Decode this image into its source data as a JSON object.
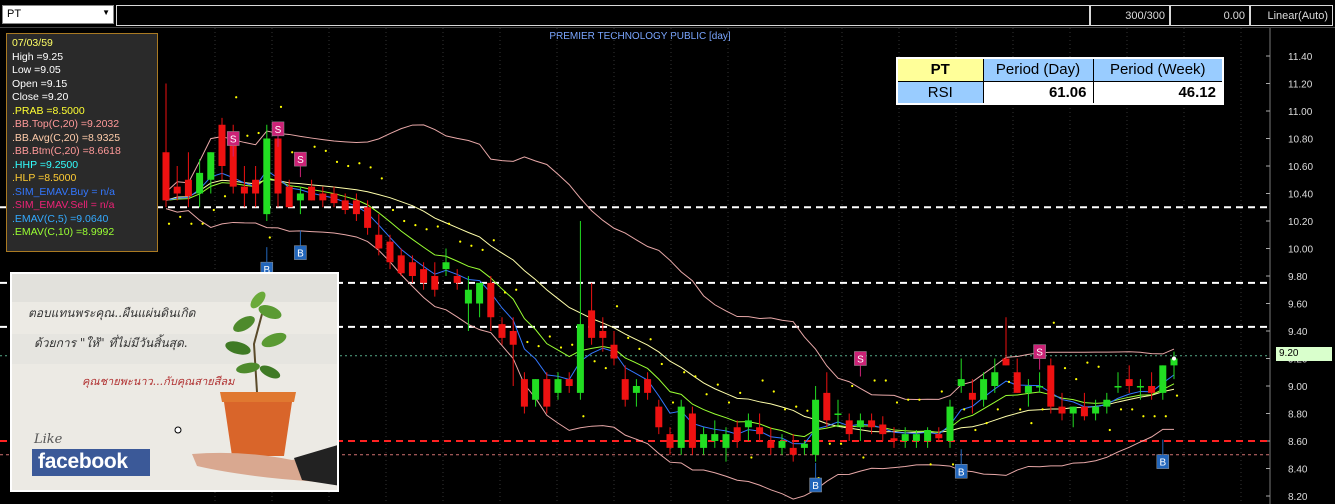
{
  "toolbar": {
    "symbol": "PT",
    "bar_count": "300/300",
    "value": "0.00",
    "scale_mode": "Linear(Auto)"
  },
  "chart": {
    "title": "PREMIER TECHNOLOGY PUBLIC [day]",
    "last_price_tag": "9.20",
    "colors": {
      "up": "#22dd22",
      "down": "#ee1111",
      "bb": "#e8a8a8",
      "ema5": "#3377ff",
      "ema10": "#99ff33",
      "emav": "#ffffaa",
      "sar": "#ffff00"
    }
  },
  "info_panel": {
    "date": "07/03/59",
    "high": "High   =9.25",
    "low": "Low    =9.05",
    "open": "Open   =9.15",
    "close": "Close  =9.20",
    "prab": ".PRAB    =8.5000",
    "bb_top": ".BB.Top(C,20)    =9.2032",
    "bb_avg": ".BB.Avg(C,20)    =8.9325",
    "bb_btm": ".BB.Btm(C,20)    =8.6618",
    "hhp": ".HHP    =9.2500",
    "hlp": ".HLP    =8.5000",
    "sim_buy": ".SIM_EMAV.Buy    = n/a",
    "sim_sell": ".SIM_EMAV.Sell    = n/a",
    "emav5": ".EMAV(C,5)    =9.0640",
    "emav10": ".EMAV(C,10)    =8.9992"
  },
  "rsi_table": {
    "symbol": "PT",
    "col_day": "Period (Day)",
    "col_week": "Period (Week)",
    "row_label": "RSI",
    "day_value": "61.06",
    "week_value": "46.12"
  },
  "promo": {
    "line1": "ตอบแทนพระคุณ..ผืนแผ่นดินเกิด",
    "line2": "ด้วยการ \"ให้\" ที่ไม่มีวันสิ้นสุด.",
    "line3": "คุณชายพะนาว...กับคุณสายสีลม",
    "like": "Like",
    "brand": "facebook"
  },
  "chart_data": {
    "type": "candlestick",
    "title": "PREMIER TECHNOLOGY PUBLIC [day]",
    "ylim": [
      8.2,
      11.6
    ],
    "y_ticks": [
      "11.40",
      "11.20",
      "11.00",
      "10.80",
      "10.60",
      "10.40",
      "10.20",
      "10.00",
      "9.80",
      "9.60",
      "9.40",
      "9.20",
      "9.00",
      "8.80",
      "8.60",
      "8.40",
      "8.20"
    ],
    "last_close": 9.2,
    "horizontal_levels": [
      10.3,
      9.75,
      9.43,
      8.6,
      8.5
    ],
    "candles": [
      {
        "o": 10.7,
        "h": 11.2,
        "l": 10.3,
        "c": 10.35
      },
      {
        "o": 10.45,
        "h": 10.6,
        "l": 10.35,
        "c": 10.4
      },
      {
        "o": 10.5,
        "h": 10.7,
        "l": 10.3,
        "c": 10.38
      },
      {
        "o": 10.4,
        "h": 10.65,
        "l": 10.3,
        "c": 10.55
      },
      {
        "o": 10.5,
        "h": 10.7,
        "l": 10.4,
        "c": 10.7
      },
      {
        "o": 10.9,
        "h": 10.95,
        "l": 10.5,
        "c": 10.6
      },
      {
        "o": 10.8,
        "h": 10.9,
        "l": 10.4,
        "c": 10.45
      },
      {
        "o": 10.45,
        "h": 10.6,
        "l": 10.3,
        "c": 10.4
      },
      {
        "o": 10.5,
        "h": 10.6,
        "l": 10.3,
        "c": 10.4
      },
      {
        "o": 10.25,
        "h": 10.9,
        "l": 10.2,
        "c": 10.8
      },
      {
        "o": 10.8,
        "h": 10.85,
        "l": 10.3,
        "c": 10.4
      },
      {
        "o": 10.45,
        "h": 10.5,
        "l": 10.3,
        "c": 10.3
      },
      {
        "o": 10.35,
        "h": 10.45,
        "l": 10.25,
        "c": 10.4
      },
      {
        "o": 10.45,
        "h": 10.5,
        "l": 10.35,
        "c": 10.35
      },
      {
        "o": 10.4,
        "h": 10.45,
        "l": 10.3,
        "c": 10.35
      },
      {
        "o": 10.4,
        "h": 10.45,
        "l": 10.3,
        "c": 10.33
      },
      {
        "o": 10.35,
        "h": 10.4,
        "l": 10.25,
        "c": 10.28
      },
      {
        "o": 10.35,
        "h": 10.4,
        "l": 10.2,
        "c": 10.25
      },
      {
        "o": 10.3,
        "h": 10.35,
        "l": 10.1,
        "c": 10.15
      },
      {
        "o": 10.1,
        "h": 10.25,
        "l": 9.95,
        "c": 10.0
      },
      {
        "o": 10.05,
        "h": 10.1,
        "l": 9.85,
        "c": 9.9
      },
      {
        "o": 9.95,
        "h": 10.0,
        "l": 9.8,
        "c": 9.82
      },
      {
        "o": 9.9,
        "h": 9.95,
        "l": 9.75,
        "c": 9.8
      },
      {
        "o": 9.85,
        "h": 9.9,
        "l": 9.7,
        "c": 9.75
      },
      {
        "o": 9.8,
        "h": 9.9,
        "l": 9.65,
        "c": 9.7
      },
      {
        "o": 9.85,
        "h": 10.0,
        "l": 9.8,
        "c": 9.9
      },
      {
        "o": 9.8,
        "h": 9.85,
        "l": 9.7,
        "c": 9.75
      },
      {
        "o": 9.6,
        "h": 9.8,
        "l": 9.4,
        "c": 9.7
      },
      {
        "o": 9.6,
        "h": 9.75,
        "l": 9.5,
        "c": 9.75
      },
      {
        "o": 9.75,
        "h": 9.8,
        "l": 9.4,
        "c": 9.5
      },
      {
        "o": 9.45,
        "h": 9.5,
        "l": 9.3,
        "c": 9.35
      },
      {
        "o": 9.4,
        "h": 9.5,
        "l": 9.0,
        "c": 9.3
      },
      {
        "o": 9.05,
        "h": 9.1,
        "l": 8.8,
        "c": 8.85
      },
      {
        "o": 8.9,
        "h": 9.05,
        "l": 8.85,
        "c": 9.05
      },
      {
        "o": 9.05,
        "h": 9.1,
        "l": 8.8,
        "c": 8.85
      },
      {
        "o": 8.95,
        "h": 9.1,
        "l": 8.9,
        "c": 9.05
      },
      {
        "o": 9.05,
        "h": 9.1,
        "l": 8.95,
        "c": 9.0
      },
      {
        "o": 8.95,
        "h": 10.2,
        "l": 8.9,
        "c": 9.45
      },
      {
        "o": 9.55,
        "h": 9.75,
        "l": 9.3,
        "c": 9.35
      },
      {
        "o": 9.4,
        "h": 9.5,
        "l": 9.25,
        "c": 9.35
      },
      {
        "o": 9.3,
        "h": 9.4,
        "l": 9.15,
        "c": 9.2
      },
      {
        "o": 9.05,
        "h": 9.15,
        "l": 8.85,
        "c": 8.9
      },
      {
        "o": 8.95,
        "h": 9.05,
        "l": 8.85,
        "c": 9.0
      },
      {
        "o": 9.05,
        "h": 9.1,
        "l": 8.9,
        "c": 8.95
      },
      {
        "o": 8.85,
        "h": 8.9,
        "l": 8.65,
        "c": 8.7
      },
      {
        "o": 8.65,
        "h": 8.7,
        "l": 8.5,
        "c": 8.55
      },
      {
        "o": 8.55,
        "h": 8.9,
        "l": 8.5,
        "c": 8.85
      },
      {
        "o": 8.8,
        "h": 8.85,
        "l": 8.5,
        "c": 8.55
      },
      {
        "o": 8.55,
        "h": 8.7,
        "l": 8.5,
        "c": 8.65
      },
      {
        "o": 8.6,
        "h": 8.75,
        "l": 8.55,
        "c": 8.65
      },
      {
        "o": 8.55,
        "h": 8.7,
        "l": 8.45,
        "c": 8.65
      },
      {
        "o": 8.7,
        "h": 8.75,
        "l": 8.55,
        "c": 8.6
      },
      {
        "o": 8.7,
        "h": 8.8,
        "l": 8.6,
        "c": 8.75
      },
      {
        "o": 8.7,
        "h": 8.8,
        "l": 8.6,
        "c": 8.65
      },
      {
        "o": 8.6,
        "h": 8.7,
        "l": 8.5,
        "c": 8.55
      },
      {
        "o": 8.55,
        "h": 8.65,
        "l": 8.5,
        "c": 8.6
      },
      {
        "o": 8.55,
        "h": 8.65,
        "l": 8.45,
        "c": 8.5
      },
      {
        "o": 8.55,
        "h": 8.6,
        "l": 8.5,
        "c": 8.58
      },
      {
        "o": 8.5,
        "h": 9.0,
        "l": 8.45,
        "c": 8.9
      },
      {
        "o": 8.95,
        "h": 9.1,
        "l": 8.7,
        "c": 8.75
      },
      {
        "o": 8.8,
        "h": 8.9,
        "l": 8.7,
        "c": 8.8
      },
      {
        "o": 8.75,
        "h": 8.8,
        "l": 8.6,
        "c": 8.65
      },
      {
        "o": 8.7,
        "h": 8.8,
        "l": 8.6,
        "c": 8.75
      },
      {
        "o": 8.75,
        "h": 8.8,
        "l": 8.65,
        "c": 8.7
      },
      {
        "o": 8.72,
        "h": 8.78,
        "l": 8.6,
        "c": 8.65
      },
      {
        "o": 8.62,
        "h": 8.7,
        "l": 8.55,
        "c": 8.6
      },
      {
        "o": 8.6,
        "h": 8.7,
        "l": 8.55,
        "c": 8.65
      },
      {
        "o": 8.6,
        "h": 8.68,
        "l": 8.55,
        "c": 8.65
      },
      {
        "o": 8.6,
        "h": 8.7,
        "l": 8.55,
        "c": 8.68
      },
      {
        "o": 8.65,
        "h": 8.7,
        "l": 8.6,
        "c": 8.62
      },
      {
        "o": 8.6,
        "h": 8.9,
        "l": 8.55,
        "c": 8.85
      },
      {
        "o": 9.0,
        "h": 9.2,
        "l": 8.95,
        "c": 9.05
      },
      {
        "o": 8.95,
        "h": 9.05,
        "l": 8.8,
        "c": 8.9
      },
      {
        "o": 8.9,
        "h": 9.1,
        "l": 8.85,
        "c": 9.05
      },
      {
        "o": 9.0,
        "h": 9.2,
        "l": 8.95,
        "c": 9.1
      },
      {
        "o": 9.2,
        "h": 9.5,
        "l": 9.15,
        "c": 9.15
      },
      {
        "o": 9.1,
        "h": 9.2,
        "l": 8.95,
        "c": 8.95
      },
      {
        "o": 8.95,
        "h": 9.05,
        "l": 8.85,
        "c": 9.0
      },
      {
        "o": 9.0,
        "h": 9.1,
        "l": 8.95,
        "c": 9.0
      },
      {
        "o": 9.15,
        "h": 9.2,
        "l": 8.8,
        "c": 8.85
      },
      {
        "o": 8.85,
        "h": 8.95,
        "l": 8.75,
        "c": 8.8
      },
      {
        "o": 8.8,
        "h": 8.85,
        "l": 8.7,
        "c": 8.85
      },
      {
        "o": 8.85,
        "h": 8.95,
        "l": 8.75,
        "c": 8.78
      },
      {
        "o": 8.8,
        "h": 8.9,
        "l": 8.75,
        "c": 8.85
      },
      {
        "o": 8.85,
        "h": 8.95,
        "l": 8.8,
        "c": 8.9
      },
      {
        "o": 9.0,
        "h": 9.1,
        "l": 8.95,
        "c": 9.0
      },
      {
        "o": 9.05,
        "h": 9.15,
        "l": 8.95,
        "c": 9.0
      },
      {
        "o": 9.0,
        "h": 9.05,
        "l": 8.9,
        "c": 9.0
      },
      {
        "o": 9.0,
        "h": 9.1,
        "l": 8.9,
        "c": 8.95
      },
      {
        "o": 8.95,
        "h": 9.15,
        "l": 8.9,
        "c": 9.15
      },
      {
        "o": 9.15,
        "h": 9.25,
        "l": 9.05,
        "c": 9.2
      }
    ],
    "signals": [
      {
        "i": 6,
        "type": "S",
        "price": 10.8
      },
      {
        "i": 10,
        "type": "S",
        "price": 10.87
      },
      {
        "i": 12,
        "type": "S",
        "price": 10.65
      },
      {
        "i": 9,
        "type": "B",
        "price": 9.85
      },
      {
        "i": 12,
        "type": "B",
        "price": 9.97
      },
      {
        "i": 62,
        "type": "S",
        "price": 9.2
      },
      {
        "i": 78,
        "type": "S",
        "price": 9.25
      },
      {
        "i": 58,
        "type": "B",
        "price": 8.28
      },
      {
        "i": 71,
        "type": "B",
        "price": 8.38
      },
      {
        "i": 89,
        "type": "B",
        "price": 8.45
      }
    ]
  }
}
